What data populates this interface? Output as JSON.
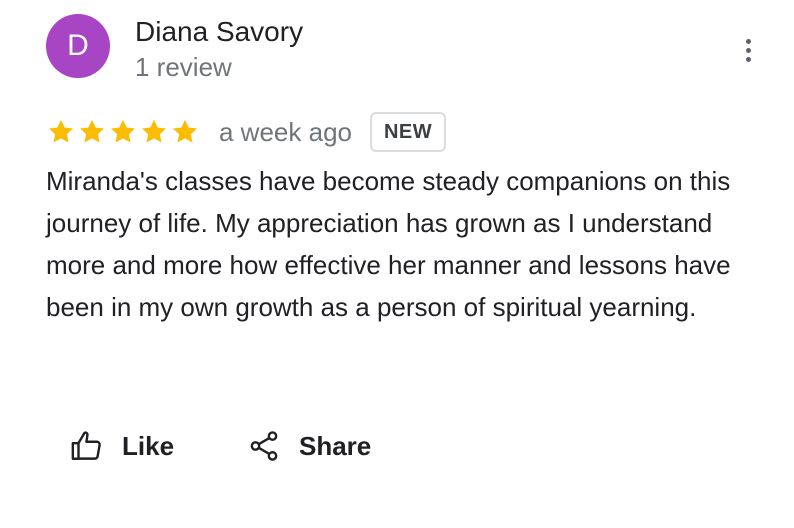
{
  "reviewer": {
    "initial": "D",
    "name": "Diana Savory",
    "review_count": "1 review",
    "avatar_color": "#a845c4"
  },
  "menu": {
    "icon": "more-vert-icon"
  },
  "rating": {
    "stars": 5,
    "max_stars": 5,
    "star_color": "#fbbc04",
    "date": "a week ago",
    "badge": "NEW"
  },
  "review": {
    "text": "Miranda's classes have become steady companions on this journey of life. My appreciation has grown as I understand more and more how effective her manner and lessons have been in my own growth as a person of spiritual yearning."
  },
  "actions": {
    "like_label": "Like",
    "like_icon": "thumbs-up-icon",
    "share_label": "Share",
    "share_icon": "share-icon"
  }
}
